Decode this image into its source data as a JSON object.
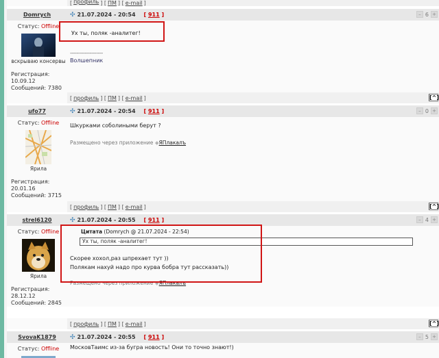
{
  "links": {
    "profile": "профиль",
    "pm": "ПМ",
    "email": "e-mail",
    "top": "[^]"
  },
  "posts": [
    {
      "user": "Domrych",
      "status_label": "Статус:",
      "status": "Offline",
      "title": "вскрываю консервы",
      "reg_label": "Регистрация:",
      "reg_date": "10.09.12",
      "msgs_label": "Сообщений:",
      "msgs": "7380",
      "date": "21.07.2024 - 20:54",
      "num": "911",
      "rating": "6",
      "text": "Ух ты, поляк -аналитег!",
      "sig_line": "--------------------",
      "sig_text": "Волшепник",
      "avatar_icon": "dark-figure-avatar"
    },
    {
      "user": "ufo77",
      "status_label": "Статус:",
      "status": "Offline",
      "title": "Ярила",
      "reg_label": "Регистрация:",
      "reg_date": "20.01.16",
      "msgs_label": "Сообщений:",
      "msgs": "3715",
      "date": "21.07.2024 - 20:54",
      "num": "911",
      "rating": "0",
      "text": "Шкурками соболиными берут ?",
      "via": "Размещено через приложение",
      "app": "ЯПлакалъ",
      "avatar_icon": "map-avatar"
    },
    {
      "user": "strel6120",
      "status_label": "Статус:",
      "status": "Offline",
      "title": "Ярила",
      "reg_label": "Регистрация:",
      "reg_date": "28.12.12",
      "msgs_label": "Сообщений:",
      "msgs": "2845",
      "date": "21.07.2024 - 20:55",
      "num": "911",
      "rating": "4",
      "quote_label": "Цитата",
      "quote_meta": "(Domrych @ 21.07.2024 - 22:54)",
      "quote_text": "Ух ты, поляк -аналитег!",
      "line1": "Скорее хохол,раз шпрехает тут ))",
      "line2": "Полякам нахуй надо про курва бобра тут рассказать))",
      "via": "Размещено через приложение",
      "app": "ЯПлакалъ",
      "avatar_icon": "doge-avatar"
    },
    {
      "user": "SvovaK1879",
      "status_label": "Статус:",
      "status": "Offline",
      "date": "21.07.2024 - 20:55",
      "num": "911",
      "rating": "5",
      "text": "МосковТаимс из-за бугра новость! Они то точно знают!)"
    }
  ],
  "colors": {
    "accent_red": "#d01414",
    "offline": "#cc0000",
    "left_bar": "#6db9a2"
  }
}
